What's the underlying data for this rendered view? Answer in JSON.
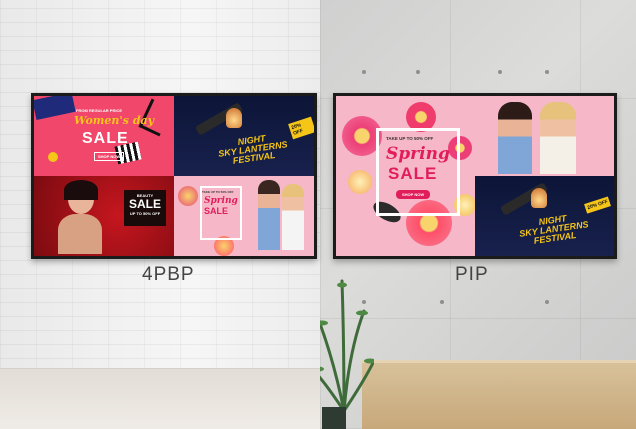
{
  "captions": {
    "left": "4PBP",
    "right": "PIP"
  },
  "panels": {
    "womens_day": {
      "kicker": "FROM REGULAR PRICE",
      "script": "Women's day",
      "headline": "SALE",
      "button": "SHOP NOW"
    },
    "night_festival": {
      "badge_line1": "20% OFF",
      "badge_line2": "",
      "line1": "NIGHT",
      "line2": "SKY LANTERNS",
      "line3": "FESTIVAL"
    },
    "beauty_sale": {
      "kicker": "BEAUTY",
      "headline": "SALE",
      "sub": "UP TO 50% OFF"
    },
    "spring_sale": {
      "kicker": "TAKE UP TO 50% OFF",
      "script": "Spring",
      "headline": "SALE",
      "button": "SHOP NOW"
    }
  },
  "colors": {
    "pink": "#f0476a",
    "light_pink": "#f6b8c8",
    "navy": "#101a3e",
    "gold": "#f5c518",
    "red": "#b3121c"
  }
}
